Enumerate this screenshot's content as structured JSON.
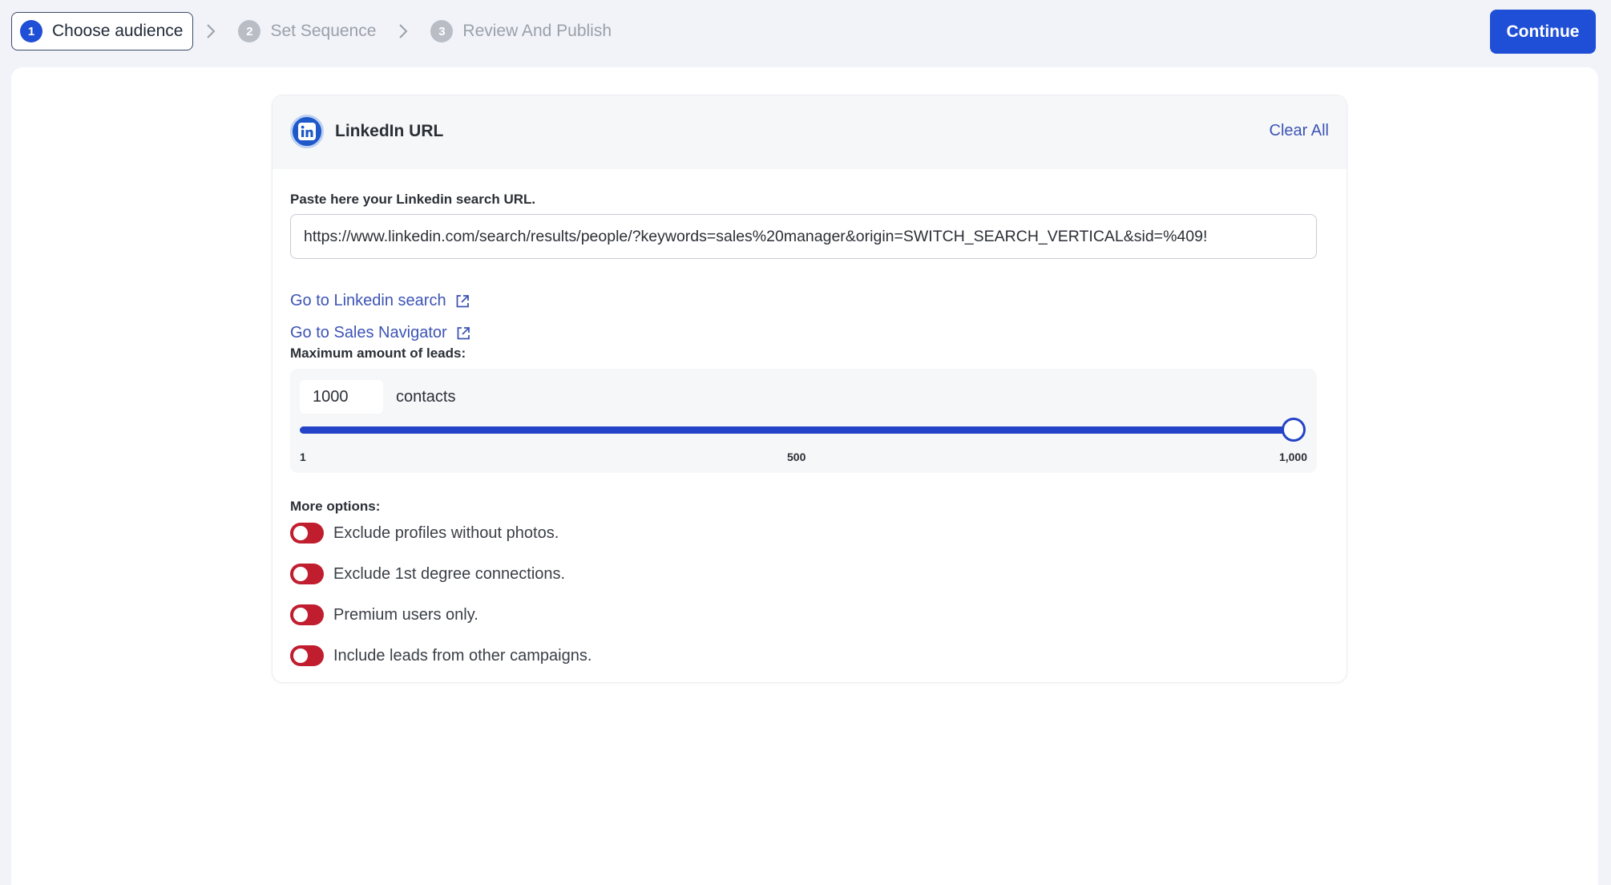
{
  "stepper": {
    "steps": [
      {
        "number": "1",
        "label": "Choose audience",
        "active": true
      },
      {
        "number": "2",
        "label": "Set Sequence",
        "active": false
      },
      {
        "number": "3",
        "label": "Review And Publish",
        "active": false
      }
    ]
  },
  "header": {
    "continue_label": "Continue"
  },
  "card": {
    "title": "LinkedIn URL",
    "clear_all_label": "Clear All",
    "url_label": "Paste here your Linkedin search URL.",
    "url_value": "https://www.linkedin.com/search/results/people/?keywords=sales%20manager&origin=SWITCH_SEARCH_VERTICAL&sid=%409!",
    "links": {
      "linkedin_search": "Go to Linkedin search",
      "sales_navigator": "Go to Sales Navigator"
    },
    "leads": {
      "label": "Maximum amount of leads:",
      "value": "1000",
      "unit": "contacts",
      "min": 1,
      "max": 1000,
      "current": 1000,
      "tick_labels": [
        "1",
        "500",
        "1,000"
      ]
    },
    "more_options": {
      "label": "More options:",
      "options": [
        {
          "label": "Exclude profiles without photos.",
          "enabled": false
        },
        {
          "label": "Exclude 1st degree connections.",
          "enabled": false
        },
        {
          "label": "Premium users only.",
          "enabled": false
        },
        {
          "label": "Include leads from other campaigns.",
          "enabled": false
        }
      ]
    }
  },
  "colors": {
    "accent": "#1f4fd6",
    "link": "#3d54b5",
    "toggle_off": "#c01d2e",
    "slider": "#2343c8"
  }
}
